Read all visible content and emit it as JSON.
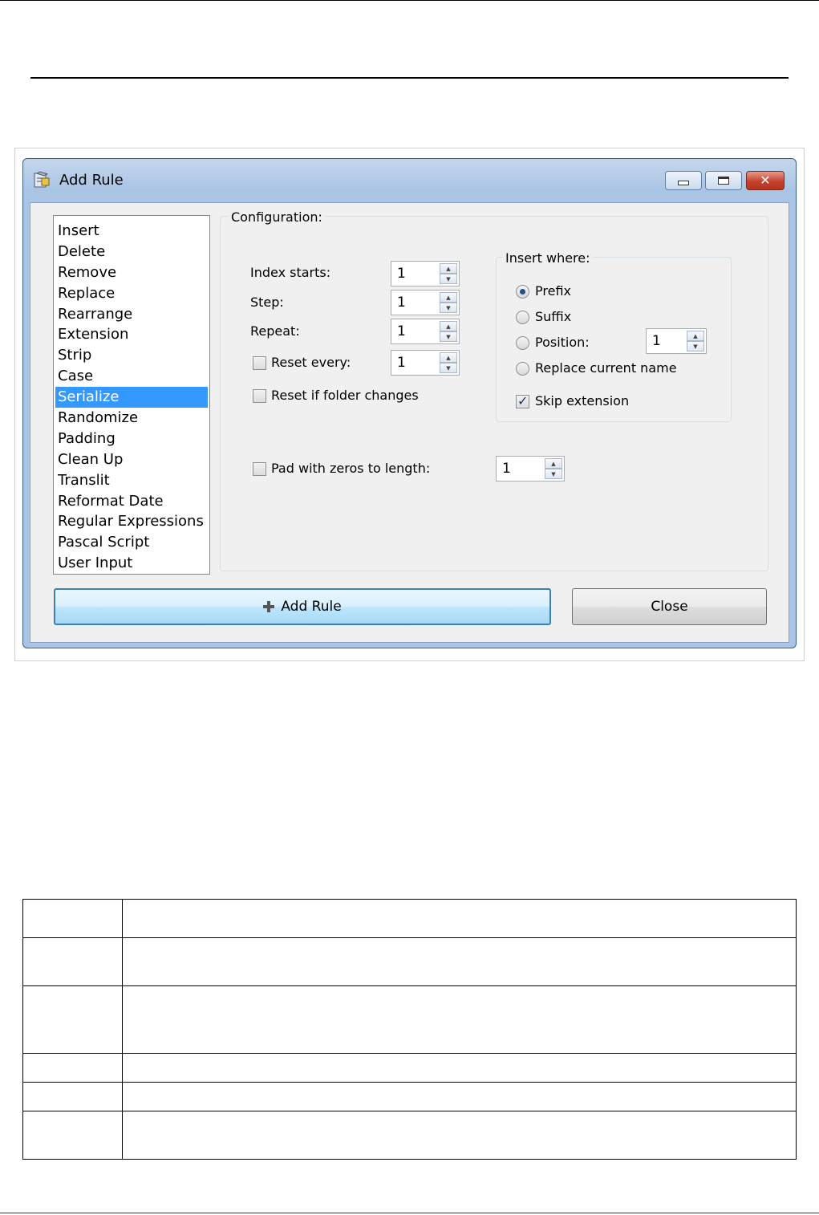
{
  "window": {
    "title": "Add Rule",
    "icon": "add-rule-app-icon",
    "controls": [
      "minimize",
      "maximize",
      "close"
    ]
  },
  "rule_list": {
    "items": [
      "Insert",
      "Delete",
      "Remove",
      "Replace",
      "Rearrange",
      "Extension",
      "Strip",
      "Case",
      "Serialize",
      "Randomize",
      "Padding",
      "Clean Up",
      "Translit",
      "Reformat Date",
      "Regular Expressions",
      "Pascal Script",
      "User Input"
    ],
    "selected": "Serialize"
  },
  "config": {
    "legend": "Configuration:",
    "index_starts": {
      "label": "Index starts:",
      "value": "1"
    },
    "step": {
      "label": "Step:",
      "value": "1"
    },
    "repeat": {
      "label": "Repeat:",
      "value": "1"
    },
    "reset_every": {
      "label": "Reset every:",
      "value": "1",
      "checked": false
    },
    "reset_folder": {
      "label": "Reset if folder changes",
      "checked": false
    },
    "pad_zeros": {
      "label": "Pad with zeros to length:",
      "value": "1",
      "checked": false
    }
  },
  "insert_where": {
    "legend": "Insert where:",
    "prefix": "Prefix",
    "suffix": "Suffix",
    "position": {
      "label": "Position:",
      "value": "1"
    },
    "replace_current": "Replace current name",
    "selected": "Prefix",
    "skip_extension": {
      "label": "Skip extension",
      "checked": true
    }
  },
  "buttons": {
    "add_rule": "Add Rule",
    "close": "Close"
  },
  "colors": {
    "selection": "#3399ff",
    "window_frame": "#a9c4e4",
    "close_button": "#c4412e"
  }
}
